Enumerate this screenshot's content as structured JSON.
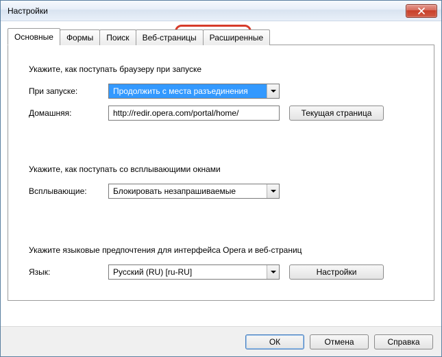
{
  "window": {
    "title": "Настройки"
  },
  "tabs": {
    "t0": "Основные",
    "t1": "Формы",
    "t2": "Поиск",
    "t3": "Веб-страницы",
    "t4": "Расширенные"
  },
  "startup": {
    "heading": "Укажите, как поступать браузеру при запуске",
    "on_start_label": "При запуске:",
    "on_start_value": "Продолжить с места разъединения",
    "home_label": "Домашняя:",
    "home_value": "http://redir.opera.com/portal/home/",
    "current_page_btn": "Текущая страница"
  },
  "popups": {
    "heading": "Укажите, как поступать со всплывающими окнами",
    "label": "Всплывающие:",
    "value": "Блокировать незапрашиваемые"
  },
  "language": {
    "heading": "Укажите языковые предпочтения для интерфейса Opera и веб-страниц",
    "label": "Язык:",
    "value": "Русский (RU) [ru-RU]",
    "settings_btn": "Настройки"
  },
  "footer": {
    "ok": "ОК",
    "cancel": "Отмена",
    "help": "Справка"
  }
}
